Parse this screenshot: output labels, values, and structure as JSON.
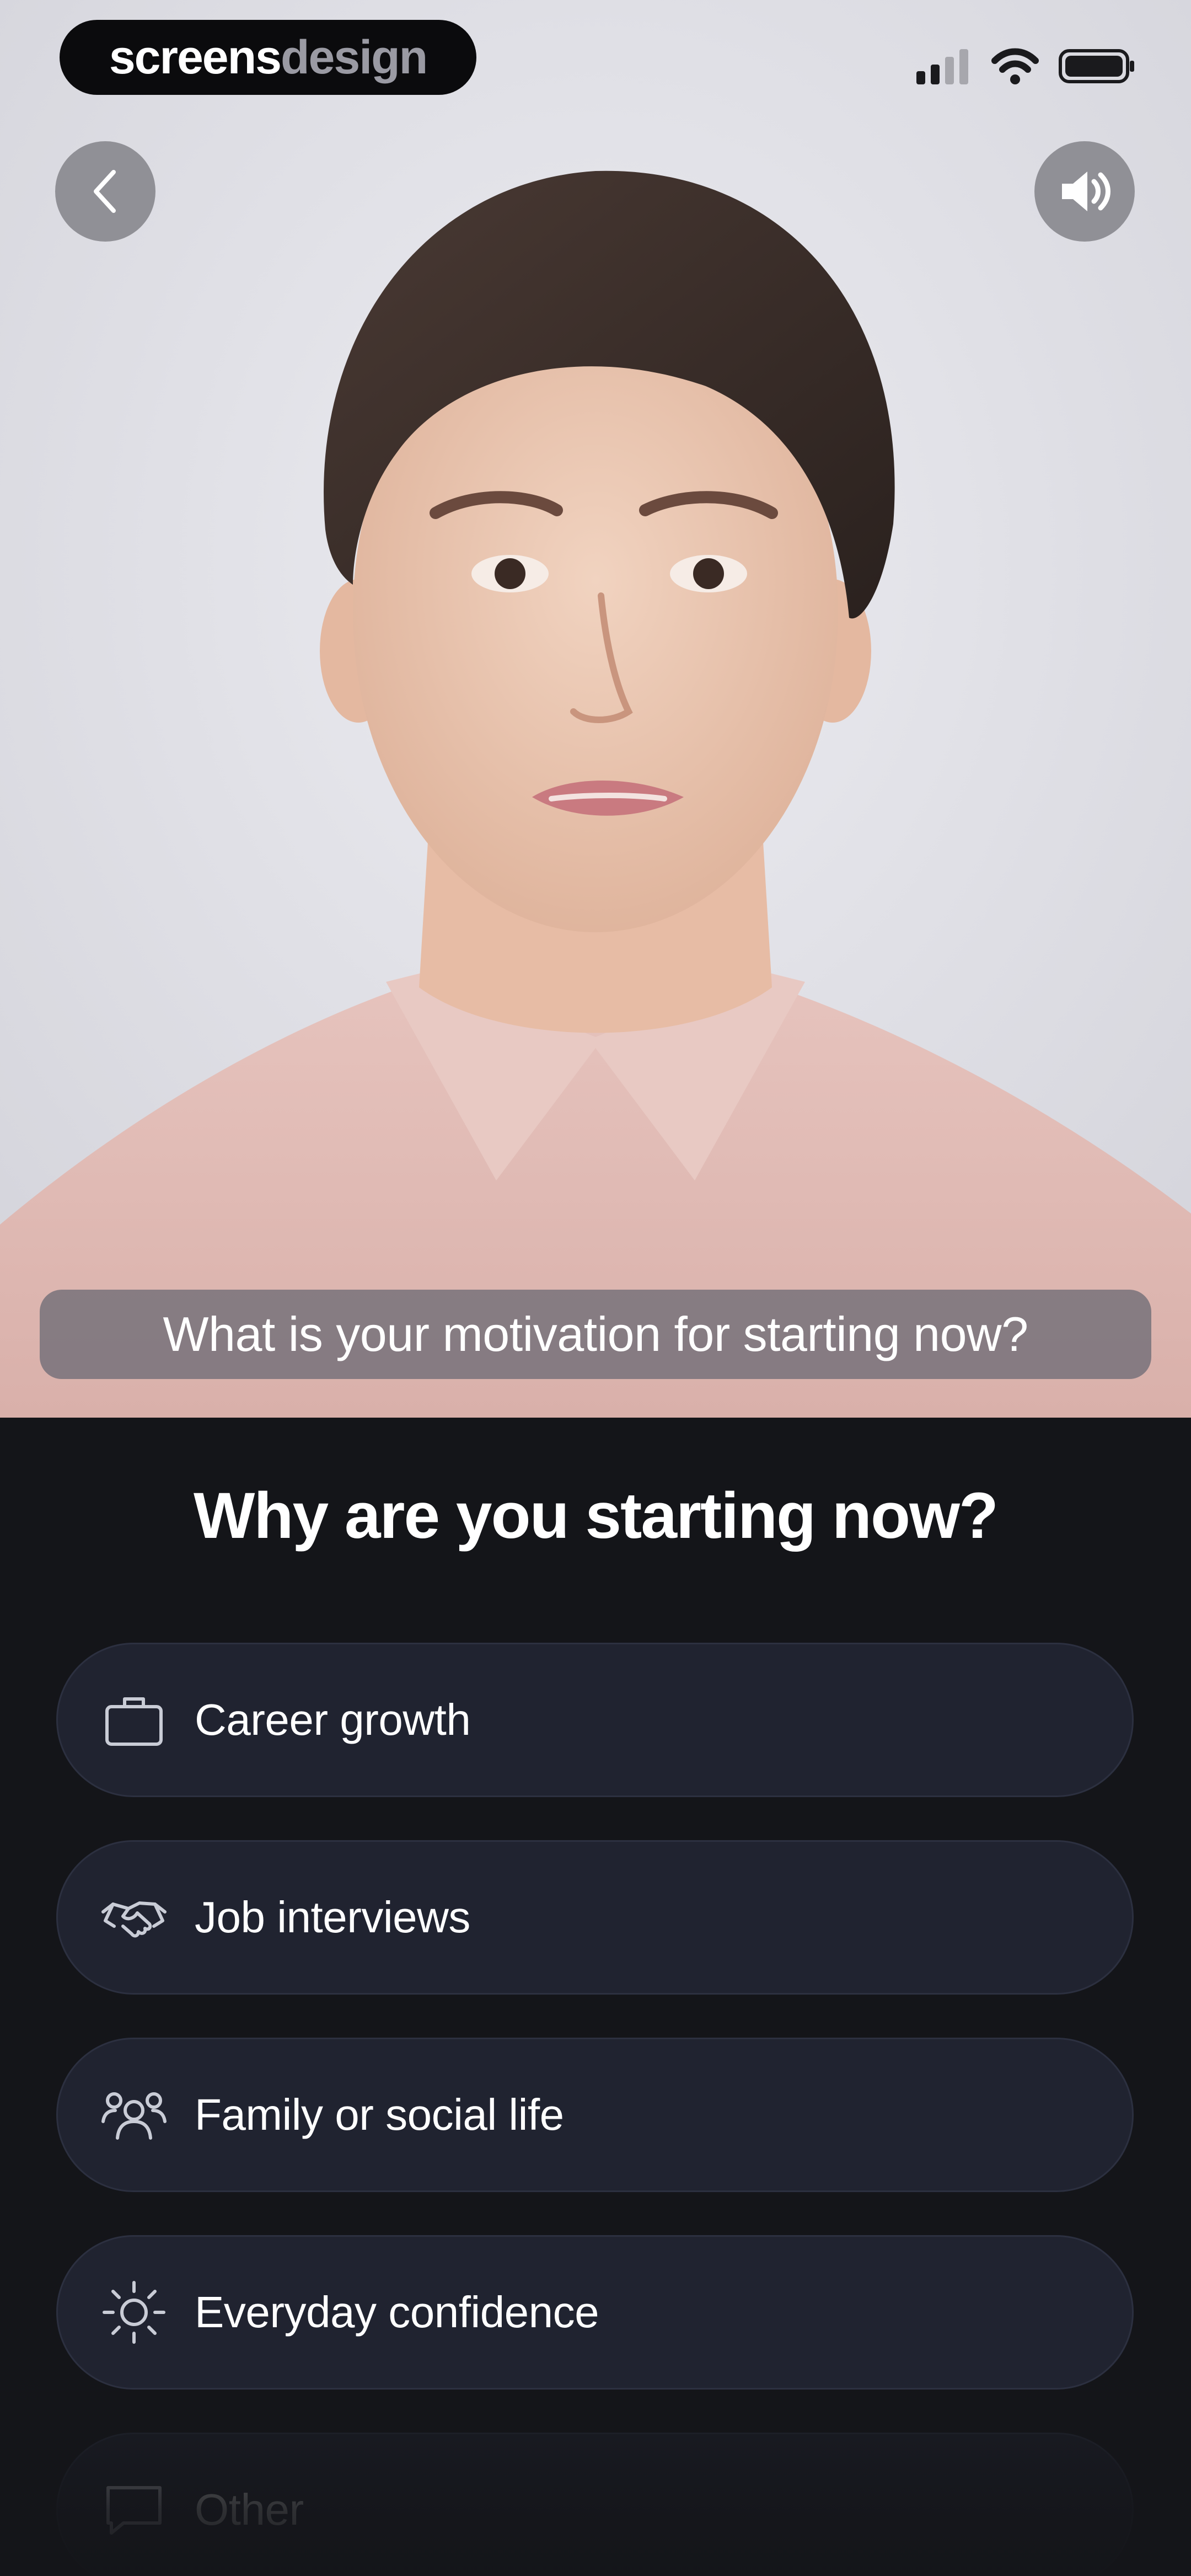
{
  "brand": {
    "logo_part1": "screens",
    "logo_part2": "design"
  },
  "video": {
    "caption": "What is your motivation for starting now?",
    "back_icon": "chevron-left-icon",
    "sound_icon": "speaker-icon"
  },
  "survey": {
    "question": "Why are you starting now?",
    "options": [
      {
        "label": "Career growth",
        "icon": "briefcase-icon"
      },
      {
        "label": "Job interviews",
        "icon": "handshake-icon"
      },
      {
        "label": "Family or social life",
        "icon": "people-icon"
      },
      {
        "label": "Everyday confidence",
        "icon": "sun-icon"
      },
      {
        "label": "Other",
        "icon": "chat-bubble-icon"
      }
    ]
  },
  "colors": {
    "panel_bg": "#141519",
    "option_bg": "#202330",
    "accent_text": "#ffffff"
  }
}
